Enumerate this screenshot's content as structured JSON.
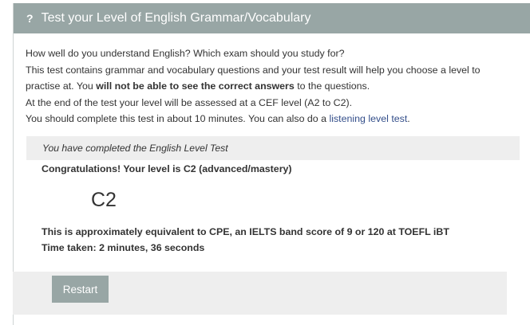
{
  "header": {
    "icon": "question-mark-icon",
    "icon_glyph": "?",
    "title": "Test your Level of English Grammar/Vocabulary"
  },
  "intro": {
    "line1": "How well do you understand English? Which exam should you study for?",
    "line2": "This test contains grammar and vocabulary questions and your test result will help you choose a level to",
    "line3_before": "practise at. You ",
    "line3_bold": "will not be able to see the correct answers",
    "line3_after": " to the questions.",
    "line4": "At the end of the test your level will be assessed at a CEF level (A2 to C2).",
    "line5_before": "You should complete this test in about 10 minutes. You can also do a ",
    "line5_link": "listening level test",
    "line5_after": "."
  },
  "result": {
    "completed_text": "You have completed the English Level Test",
    "congrats_text": "Congratulations! Your level is C2 (advanced/mastery)",
    "level": "C2",
    "equivalent_text": "This is approximately equivalent to CPE, an IELTS band score of 9 or 120 at TOEFL iBT",
    "time_taken": "Time taken: 2 minutes, 36 seconds"
  },
  "actions": {
    "restart_label": "Restart"
  },
  "colors": {
    "header_bg": "#98a6a5",
    "link": "#334e8a",
    "panel_grey": "#eeeeee"
  }
}
